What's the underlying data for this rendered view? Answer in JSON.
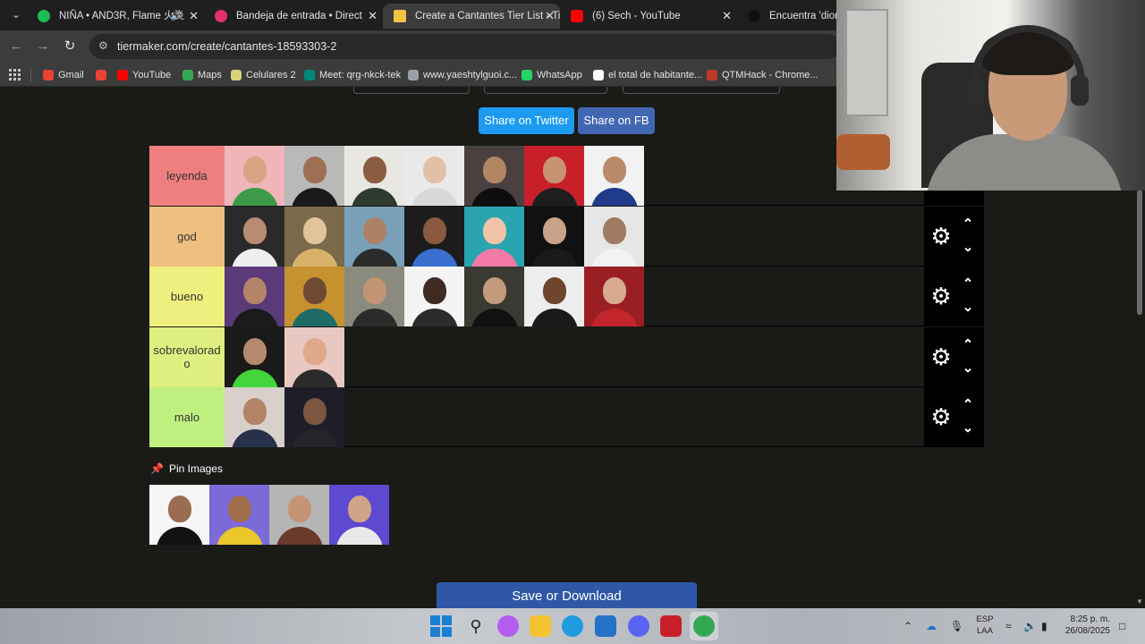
{
  "tabs": [
    {
      "title": "NIÑA • AND3R, Flame 火炎",
      "favicon_color": "#1db954",
      "icon": "spotify-icon",
      "active": false,
      "playing": true
    },
    {
      "title": "Bandeja de entrada • Direct",
      "favicon_color": "#e1306c",
      "icon": "instagram-icon",
      "active": false
    },
    {
      "title": "Create a Cantantes Tier List - Ti",
      "favicon_color": "#f5c242",
      "icon": "tiermaker-icon",
      "active": true
    },
    {
      "title": "(6) Sech - YouTube",
      "favicon_color": "#ff0000",
      "icon": "youtube-icon",
      "active": false
    },
    {
      "title": "Encuentra 'diomed",
      "favicon_color": "#111111",
      "icon": "tiktok-icon",
      "active": false
    }
  ],
  "address": {
    "url": "tiermaker.com/create/cantantes-18593303-2"
  },
  "bookmarks": [
    {
      "label": "Gmail",
      "color": "#ea4335",
      "icon": "gmail-icon"
    },
    {
      "label": "",
      "color": "#ea4335",
      "icon": "gmail-m-icon"
    },
    {
      "label": "YouTube",
      "color": "#ff0000",
      "icon": "youtube-icon"
    },
    {
      "label": "Maps",
      "color": "#34a853",
      "icon": "maps-icon"
    },
    {
      "label": "Celulares 2",
      "color": "#d9d27a",
      "icon": "folder-icon"
    },
    {
      "label": "Meet: qrg-nkck-tek",
      "color": "#00897b",
      "icon": "meet-icon"
    },
    {
      "label": "www.yaeshtylguoi.c...",
      "color": "#9aa0a6",
      "icon": "globe-icon"
    },
    {
      "label": "WhatsApp",
      "color": "#25d366",
      "icon": "whatsapp-icon"
    },
    {
      "label": "el total de habitante...",
      "color": "#ffffff",
      "icon": "google-icon"
    },
    {
      "label": "QTMHack - Chrome...",
      "color": "#c0392b",
      "icon": "image-icon"
    }
  ],
  "share": {
    "twitter": "Share on Twitter",
    "facebook": "Share on FB"
  },
  "tiers": [
    {
      "label": "leyenda",
      "color": "#ef7f7f",
      "items": [
        {
          "bg": "#f0b5b8",
          "skin": "#d8a483",
          "shirt": "#3e9b4b"
        },
        {
          "bg": "#b9b9b9",
          "skin": "#9e6f52",
          "shirt": "#1a1a1a"
        },
        {
          "bg": "#e9e7e2",
          "skin": "#8a5c40",
          "shirt": "#2f3a30"
        },
        {
          "bg": "#eae9ea",
          "skin": "#e1c0a6",
          "shirt": "#d8d8d8"
        },
        {
          "bg": "#4a4040",
          "skin": "#b28563",
          "shirt": "#0e0e0e"
        },
        {
          "bg": "#c8202a",
          "skin": "#c89370",
          "shirt": "#1e1e1e"
        },
        {
          "bg": "#f2f2f2",
          "skin": "#b98a6b",
          "shirt": "#1f3b8a"
        }
      ]
    },
    {
      "label": "god",
      "color": "#efbf7f",
      "items": [
        {
          "bg": "#2a2a2a",
          "skin": "#b88c70",
          "shirt": "#efefef"
        },
        {
          "bg": "#7a6a4a",
          "skin": "#e3c39c",
          "shirt": "#d9b26a"
        },
        {
          "bg": "#7aa0b9",
          "skin": "#ad8168",
          "shirt": "#2b2b2b"
        },
        {
          "bg": "#1c1c1c",
          "skin": "#8b5a3e",
          "shirt": "#3a6fd0"
        },
        {
          "bg": "#2aa5b0",
          "skin": "#f1c3a8",
          "shirt": "#f37aa6"
        },
        {
          "bg": "#111111",
          "skin": "#c9a389",
          "shirt": "#1a1a1a"
        },
        {
          "bg": "#e6e6e6",
          "skin": "#9f7b64",
          "shirt": "#f2f2f2"
        }
      ]
    },
    {
      "label": "bueno",
      "color": "#efef7f",
      "items": [
        {
          "bg": "#5b3a7a",
          "skin": "#b38468",
          "shirt": "#1b1b1b"
        },
        {
          "bg": "#c6912f",
          "skin": "#6f4a33",
          "shirt": "#1f6b66"
        },
        {
          "bg": "#8a8a7e",
          "skin": "#c19474",
          "shirt": "#2b2b2b"
        },
        {
          "bg": "#f4f4f4",
          "skin": "#3f2b22",
          "shirt": "#2c2c2c"
        },
        {
          "bg": "#3a3a32",
          "skin": "#c49a7c",
          "shirt": "#111111"
        },
        {
          "bg": "#ededed",
          "skin": "#6f452e",
          "shirt": "#1a1a1a"
        },
        {
          "bg": "#9a1f23",
          "skin": "#d8ab8f",
          "shirt": "#c2262c"
        }
      ]
    },
    {
      "label": "sobrevalorado",
      "color": "#dfef7f",
      "items": [
        {
          "bg": "#1a1a1a",
          "skin": "#b58a6c",
          "shirt": "#43d63a"
        },
        {
          "bg": "#e8c8c0",
          "skin": "#e0a88a",
          "shirt": "#2b2b2b"
        }
      ]
    },
    {
      "label": "malo",
      "color": "#bfef7f",
      "items": [
        {
          "bg": "#d9d0cc",
          "skin": "#b28468",
          "shirt": "#27324a"
        },
        {
          "bg": "#1e1e28",
          "skin": "#7b5640",
          "shirt": "#25252a"
        }
      ]
    }
  ],
  "pin": {
    "title": "Pin Images",
    "items": [
      {
        "bg": "#f5f5f5",
        "skin": "#9a6c50",
        "shirt": "#111111"
      },
      {
        "bg": "#7b6ad8",
        "skin": "#a06d4d",
        "shirt": "#e9c62a"
      },
      {
        "bg": "#b5b5b5",
        "skin": "#c49474",
        "shirt": "#6a3a2a"
      },
      {
        "bg": "#5d4ad0",
        "skin": "#d0a487",
        "shirt": "#e9e9e9"
      }
    ]
  },
  "save_label": "Save or Download",
  "system": {
    "lang_line1": "ESP",
    "lang_line2": "LAA",
    "time": "8:25 p. m.",
    "date": "26/08/2025"
  },
  "taskbar_apps": [
    {
      "name": "copilot-icon",
      "color": "#b45cf0"
    },
    {
      "name": "file-explorer-icon",
      "color": "#f4c430"
    },
    {
      "name": "edge-icon",
      "color": "#1f9be0"
    },
    {
      "name": "store-icon",
      "color": "#2473c6"
    },
    {
      "name": "discord-icon",
      "color": "#5865f2"
    },
    {
      "name": "voicemeeter-icon",
      "color": "#c8202a"
    },
    {
      "name": "chrome-icon",
      "color": "#34a853"
    }
  ]
}
